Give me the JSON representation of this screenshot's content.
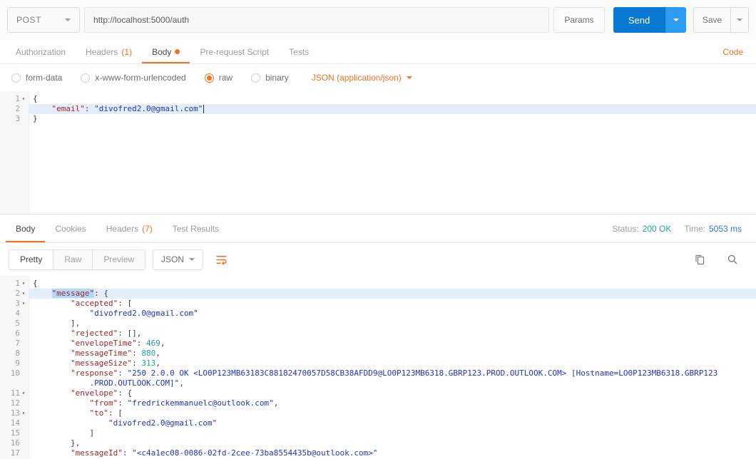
{
  "request_bar": {
    "method": "POST",
    "url": "http://localhost:5000/auth",
    "params_label": "Params",
    "send_label": "Send",
    "save_label": "Save"
  },
  "request_tabs": {
    "items": [
      {
        "label": "Authorization"
      },
      {
        "label": "Headers",
        "count": "(1)"
      },
      {
        "label": "Body"
      },
      {
        "label": "Pre-request Script"
      },
      {
        "label": "Tests"
      }
    ],
    "code_link": "Code"
  },
  "body_type": {
    "options": [
      "form-data",
      "x-www-form-urlencoded",
      "raw",
      "binary"
    ],
    "selected": "raw",
    "content_type": "JSON (application/json)"
  },
  "colors": {
    "accent": "#F47023",
    "send_blue": "#0A79D2",
    "status_teal": "#23A39B",
    "time_blue": "#2E7CE0"
  },
  "request_editor": {
    "lines": [
      {
        "n": 1,
        "fold": true,
        "tokens": [
          [
            "p",
            "{"
          ]
        ]
      },
      {
        "n": 2,
        "hl": true,
        "cursor": true,
        "tokens": [
          [
            "p",
            "    "
          ],
          [
            "k",
            "\"email\""
          ],
          [
            "p",
            ": "
          ],
          [
            "s",
            "\"divofred2.0@gmail.com\""
          ]
        ]
      },
      {
        "n": 3,
        "tokens": [
          [
            "p",
            "}"
          ]
        ]
      }
    ]
  },
  "response": {
    "tabs": [
      {
        "label": "Body"
      },
      {
        "label": "Cookies"
      },
      {
        "label": "Headers",
        "count": "(7)"
      },
      {
        "label": "Test Results"
      }
    ],
    "status_label": "Status:",
    "status_value": "200 OK",
    "time_label": "Time:",
    "time_value": "5053 ms",
    "view_modes": [
      "Pretty",
      "Raw",
      "Preview"
    ],
    "active_view": "Pretty",
    "format": "JSON",
    "icons": [
      "wrap-text",
      "copy",
      "search"
    ],
    "editor": {
      "lines": [
        {
          "n": 1,
          "fold": true,
          "tokens": [
            [
              "p",
              "{"
            ]
          ]
        },
        {
          "n": 2,
          "fold": true,
          "hl": true,
          "tokens": [
            [
              "p",
              "    "
            ],
            [
              "ks",
              "\"message\""
            ],
            [
              "p",
              ": {"
            ]
          ]
        },
        {
          "n": 3,
          "fold": true,
          "tokens": [
            [
              "p",
              "        "
            ],
            [
              "k",
              "\"accepted\""
            ],
            [
              "p",
              ": ["
            ]
          ]
        },
        {
          "n": 4,
          "tokens": [
            [
              "p",
              "            "
            ],
            [
              "s",
              "\"divofred2.0@gmail.com\""
            ]
          ]
        },
        {
          "n": 5,
          "tokens": [
            [
              "p",
              "        ],"
            ]
          ]
        },
        {
          "n": 6,
          "tokens": [
            [
              "p",
              "        "
            ],
            [
              "k",
              "\"rejected\""
            ],
            [
              "p",
              ": [],"
            ]
          ]
        },
        {
          "n": 7,
          "tokens": [
            [
              "p",
              "        "
            ],
            [
              "k",
              "\"envelopeTime\""
            ],
            [
              "p",
              ": "
            ],
            [
              "n",
              "469"
            ],
            [
              "p",
              ","
            ]
          ]
        },
        {
          "n": 8,
          "tokens": [
            [
              "p",
              "        "
            ],
            [
              "k",
              "\"messageTime\""
            ],
            [
              "p",
              ": "
            ],
            [
              "n",
              "880"
            ],
            [
              "p",
              ","
            ]
          ]
        },
        {
          "n": 9,
          "tokens": [
            [
              "p",
              "        "
            ],
            [
              "k",
              "\"messageSize\""
            ],
            [
              "p",
              ": "
            ],
            [
              "n",
              "313"
            ],
            [
              "p",
              ","
            ]
          ]
        },
        {
          "n": 10,
          "tokens": [
            [
              "p",
              "        "
            ],
            [
              "k",
              "\"response\""
            ],
            [
              "p",
              ": "
            ],
            [
              "s",
              "\"250 2.0.0 OK <LO0P123MB63183C88182470057D58CB38AFDD9@LO0P123MB6318.GBRP123.PROD.OUTLOOK.COM> [Hostname=LO0P123MB6318.GBRP123"
            ]
          ],
          "wrap": [
            [
              "s",
              "            .PROD.OUTLOOK.COM]\""
            ],
            [
              "p",
              ","
            ]
          ]
        },
        {
          "n": 11,
          "fold": true,
          "tokens": [
            [
              "p",
              "        "
            ],
            [
              "k",
              "\"envelope\""
            ],
            [
              "p",
              ": {"
            ]
          ]
        },
        {
          "n": 12,
          "tokens": [
            [
              "p",
              "            "
            ],
            [
              "k",
              "\"from\""
            ],
            [
              "p",
              ": "
            ],
            [
              "s",
              "\"fredrickemmanuelc@outlook.com\""
            ],
            [
              "p",
              ","
            ]
          ]
        },
        {
          "n": 13,
          "fold": true,
          "tokens": [
            [
              "p",
              "            "
            ],
            [
              "k",
              "\"to\""
            ],
            [
              "p",
              ": ["
            ]
          ]
        },
        {
          "n": 14,
          "tokens": [
            [
              "p",
              "                "
            ],
            [
              "s",
              "\"divofred2.0@gmail.com\""
            ]
          ]
        },
        {
          "n": 15,
          "tokens": [
            [
              "p",
              "            ]"
            ]
          ]
        },
        {
          "n": 16,
          "tokens": [
            [
              "p",
              "        },"
            ]
          ]
        },
        {
          "n": 17,
          "tokens": [
            [
              "p",
              "        "
            ],
            [
              "k",
              "\"messageId\""
            ],
            [
              "p",
              ": "
            ],
            [
              "s",
              "\"<c4a1ec08-0086-02fd-2cee-73ba8554435b@outlook.com>\""
            ]
          ]
        }
      ]
    }
  }
}
